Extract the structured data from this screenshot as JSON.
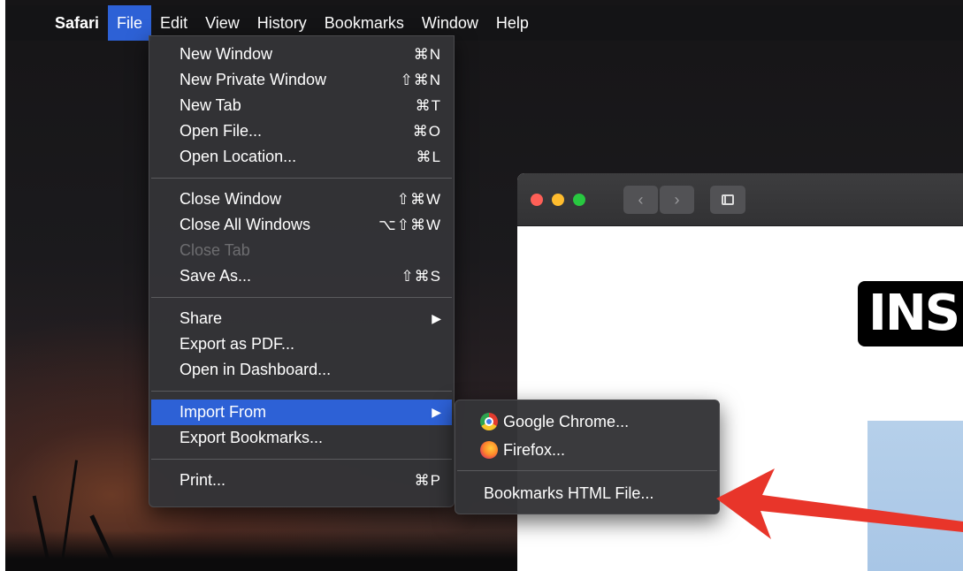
{
  "menubar": {
    "apple_glyph": "",
    "app_name": "Safari",
    "items": [
      "File",
      "Edit",
      "View",
      "History",
      "Bookmarks",
      "Window",
      "Help"
    ]
  },
  "file_menu": {
    "groups": [
      [
        {
          "label": "New Window",
          "shortcut": "⌘N"
        },
        {
          "label": "New Private Window",
          "shortcut": "⇧⌘N"
        },
        {
          "label": "New Tab",
          "shortcut": "⌘T"
        },
        {
          "label": "Open File...",
          "shortcut": "⌘O"
        },
        {
          "label": "Open Location...",
          "shortcut": "⌘L"
        }
      ],
      [
        {
          "label": "Close Window",
          "shortcut": "⇧⌘W"
        },
        {
          "label": "Close All Windows",
          "shortcut": "⌥⇧⌘W"
        },
        {
          "label": "Close Tab",
          "shortcut": ""
        },
        {
          "label": "Save As...",
          "shortcut": "⇧⌘S"
        }
      ],
      [
        {
          "label": "Share",
          "shortcut": "▶"
        },
        {
          "label": "Export as PDF...",
          "shortcut": ""
        },
        {
          "label": "Open in Dashboard...",
          "shortcut": ""
        }
      ],
      [
        {
          "label": "Import From",
          "shortcut": "▶"
        },
        {
          "label": "Export Bookmarks...",
          "shortcut": ""
        }
      ],
      [
        {
          "label": "Print...",
          "shortcut": "⌘P"
        }
      ]
    ]
  },
  "import_submenu": {
    "chrome_label": "Google Chrome...",
    "firefox_label": "Firefox...",
    "bookmarks_html_label": "Bookmarks HTML File..."
  },
  "browser": {
    "back_glyph": "‹",
    "forward_glyph": "›",
    "logo_text": "INS"
  },
  "colors": {
    "selection_blue": "#2d61d6",
    "traffic_red": "#fe5f57",
    "traffic_yellow": "#febc2e",
    "traffic_green": "#28c840",
    "arrow_red": "#e8352a"
  }
}
